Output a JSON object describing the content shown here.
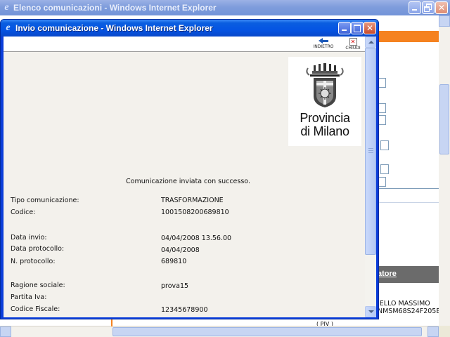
{
  "outer_window": {
    "title": "Elenco comunicazioni - Windows Internet Explorer",
    "background_link": "atore",
    "background_name": "IELLO MASSIMO",
    "background_code": "NMSM68S24F205E",
    "background_small": "( PIV )"
  },
  "popup_window": {
    "title": "Invio comunicazione - Windows Internet Explorer"
  },
  "toolbar": {
    "back_label": "INDIETRO",
    "close_label": "CHIUDI"
  },
  "logo": {
    "line1": "Provincia",
    "line2": "di Milano"
  },
  "message": "Comunicazione inviata con successo.",
  "details": [
    {
      "label": "Tipo comunicazione:",
      "value": "TRASFORMAZIONE"
    },
    {
      "label": "Codice:",
      "value": "1001508200689810"
    },
    {
      "label": "Data invio:",
      "value": "04/04/2008 13.56.00"
    },
    {
      "label": "Data protocollo:",
      "value": "04/04/2008"
    },
    {
      "label": "N. protocollo:",
      "value": "689810"
    },
    {
      "label": "Ragione sociale:",
      "value": "prova15"
    },
    {
      "label": "Partita Iva:",
      "value": ""
    },
    {
      "label": "Codice Fiscale:",
      "value": "12345678900"
    }
  ],
  "colors": {
    "accent_orange": "#f58220",
    "titlebar_blue": "#0554e3"
  }
}
